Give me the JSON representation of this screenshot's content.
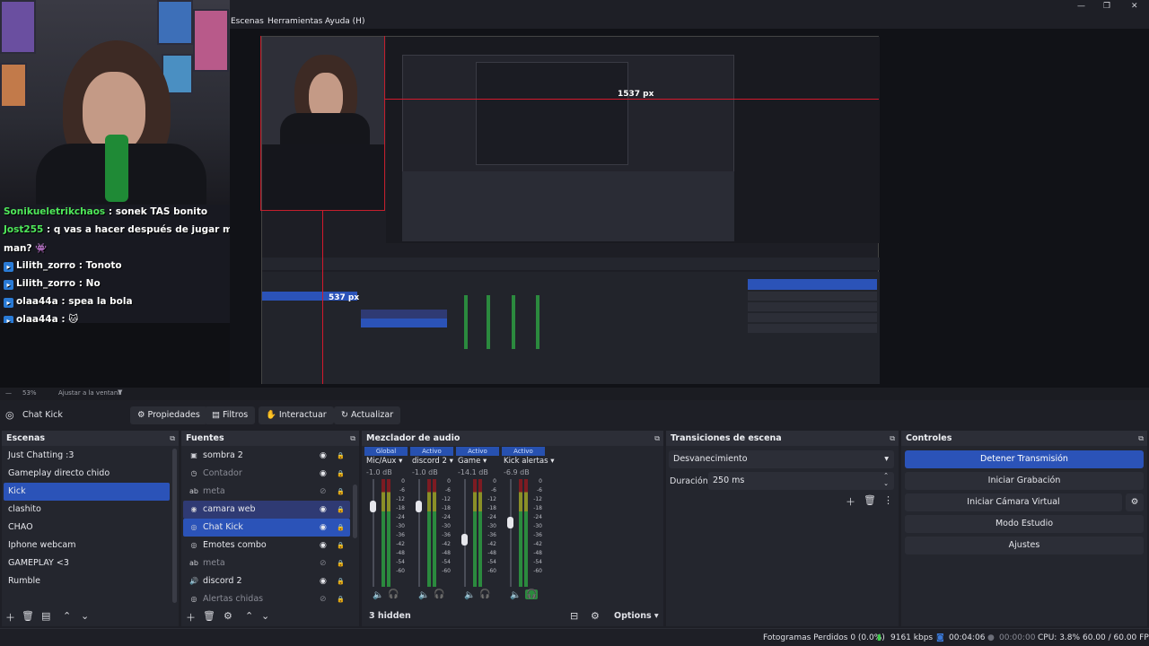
{
  "window": {
    "minimize": "—",
    "maximize": "❐",
    "close": "✕"
  },
  "menu": [
    "Escenas",
    "Herramientas",
    "Ayuda (H)"
  ],
  "chat": [
    {
      "user": "Sonikueletrikchaos",
      "user_color": "#4fe85a",
      "text": " : sonek TAS bonito",
      "badge": false
    },
    {
      "user": "Jost255",
      "user_color": "#4fe85a",
      "text": " : q vas a hacer después de jugar mega",
      "badge": false
    },
    {
      "user": "",
      "user_color": "#ffffff",
      "text": "man? 👾",
      "badge": false
    },
    {
      "user": "Lilith_zorro",
      "user_color": "#ffffff",
      "text": " : Tonoto",
      "badge": true
    },
    {
      "user": "Lilith_zorro",
      "user_color": "#ffffff",
      "text": " : No",
      "badge": true
    },
    {
      "user": "olaa44a",
      "user_color": "#ffffff",
      "text": " : spea la bola",
      "badge": true
    },
    {
      "user": "olaa44a",
      "user_color": "#ffffff",
      "text": " : 🐱",
      "badge": true
    }
  ],
  "preview": {
    "measure_h": "1537 px",
    "measure_v": "537 px",
    "zoom": "53%",
    "fit": "Ajustar a la ventana"
  },
  "toolbar": {
    "source": "Chat Kick",
    "props": "Propiedades",
    "filters": "Filtros",
    "interact": "Interactuar",
    "refresh": "Actualizar"
  },
  "scenes": {
    "title": "Escenas",
    "items": [
      "Just Chatting :3",
      "Gameplay directo chido",
      "Kick",
      "clashito",
      "CHAO",
      "Iphone webcam",
      "GAMEPLAY <3",
      "Rumble"
    ],
    "selected": 2
  },
  "sources": {
    "title": "Fuentes",
    "items": [
      {
        "name": "sombra 2",
        "icon": "▣",
        "visible": true,
        "dim": false,
        "sel": false
      },
      {
        "name": "Contador",
        "icon": "◷",
        "visible": true,
        "dim": true,
        "sel": false
      },
      {
        "name": "meta",
        "icon": "ab",
        "visible": false,
        "dim": true,
        "sel": false
      },
      {
        "name": "camara web",
        "icon": "◉",
        "visible": true,
        "dim": false,
        "sel": true
      },
      {
        "name": "Chat Kick",
        "icon": "◎",
        "visible": true,
        "dim": false,
        "sel": true
      },
      {
        "name": "Emotes combo",
        "icon": "◎",
        "visible": true,
        "dim": false,
        "sel": false
      },
      {
        "name": "meta",
        "icon": "ab",
        "visible": false,
        "dim": true,
        "sel": false
      },
      {
        "name": "discord 2",
        "icon": "🔊",
        "visible": true,
        "dim": false,
        "sel": false
      },
      {
        "name": "Alertas chidas",
        "icon": "◎",
        "visible": false,
        "dim": true,
        "sel": false
      }
    ]
  },
  "mixer": {
    "title": "Mezclador de audio",
    "hidden": "3 hidden",
    "options": "Options",
    "channels": [
      {
        "tag": "Global",
        "name": "Mic/Aux",
        "db": "-1.0 dB",
        "level": 0.78
      },
      {
        "tag": "Activo",
        "name": "discord 2",
        "db": "-1.0 dB",
        "level": 0.78
      },
      {
        "tag": "Activo",
        "name": "Game",
        "db": "-14.1 dB",
        "level": 0.45
      },
      {
        "tag": "Activo",
        "name": "Kick alertas",
        "db": "-6.9 dB",
        "level": 0.62
      }
    ],
    "scale": [
      "0",
      "-6",
      "-12",
      "-18",
      "-24",
      "-30",
      "-36",
      "-42",
      "-48",
      "-54",
      "-60"
    ]
  },
  "transitions": {
    "title": "Transiciones de escena",
    "type": "Desvanecimiento",
    "duration_label": "Duración",
    "duration": "250 ms"
  },
  "controls": {
    "title": "Controles",
    "buttons": [
      "Detener Transmisión",
      "Iniciar Grabación",
      "Iniciar Cámara Virtual",
      "Modo Estudio",
      "Ajustes"
    ]
  },
  "status": {
    "dropped": "Fotogramas Perdidos 0 (0.0%)",
    "kbps": "9161 kbps",
    "live": "00:04:06",
    "rec": "00:00:00",
    "cpu": "CPU: 3.8%",
    "fps": "60.00 / 60.00 FPS"
  },
  "colors": {
    "accent": "#2b53b8",
    "marker": "#d3192c"
  }
}
